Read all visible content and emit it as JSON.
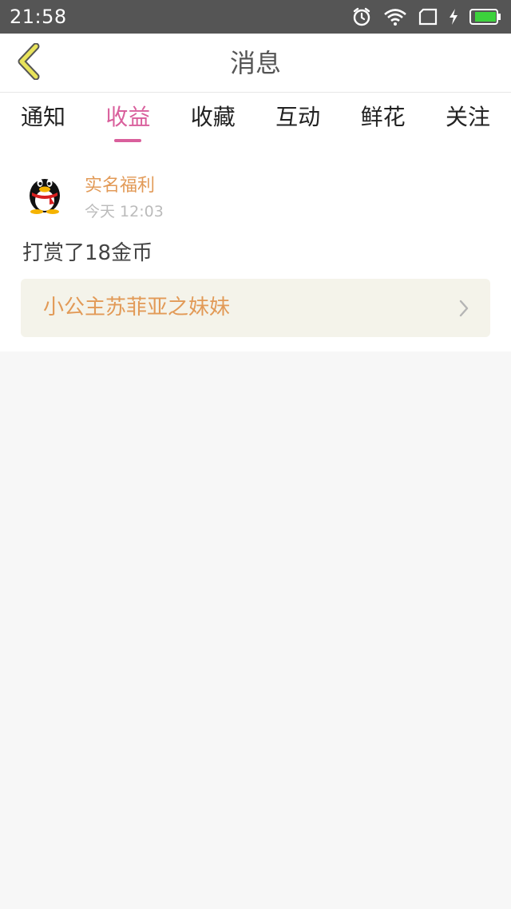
{
  "status_bar": {
    "time": "21:58",
    "icons": [
      "alarm-icon",
      "wifi-icon",
      "sim-icon",
      "charging-icon",
      "battery-icon"
    ],
    "background": "#555555"
  },
  "nav": {
    "title": "消息",
    "back_icon": "chevron-left-icon",
    "back_icon_color": "#e8e35a"
  },
  "tabs": [
    {
      "label": "通知",
      "active": false
    },
    {
      "label": "收益",
      "active": true
    },
    {
      "label": "收藏",
      "active": false
    },
    {
      "label": "互动",
      "active": false
    },
    {
      "label": "鲜花",
      "active": false
    },
    {
      "label": "关注",
      "active": false
    }
  ],
  "message": {
    "sender": "实名福利",
    "time": "今天 12:03",
    "text": "打赏了18金币",
    "link_text": "小公主苏菲亚之妹妹",
    "avatar_icon": "penguin-avatar-icon"
  },
  "colors": {
    "accent_pink": "#d95f9c",
    "accent_orange": "#e29a57",
    "card_bg": "#f4f3ea"
  }
}
